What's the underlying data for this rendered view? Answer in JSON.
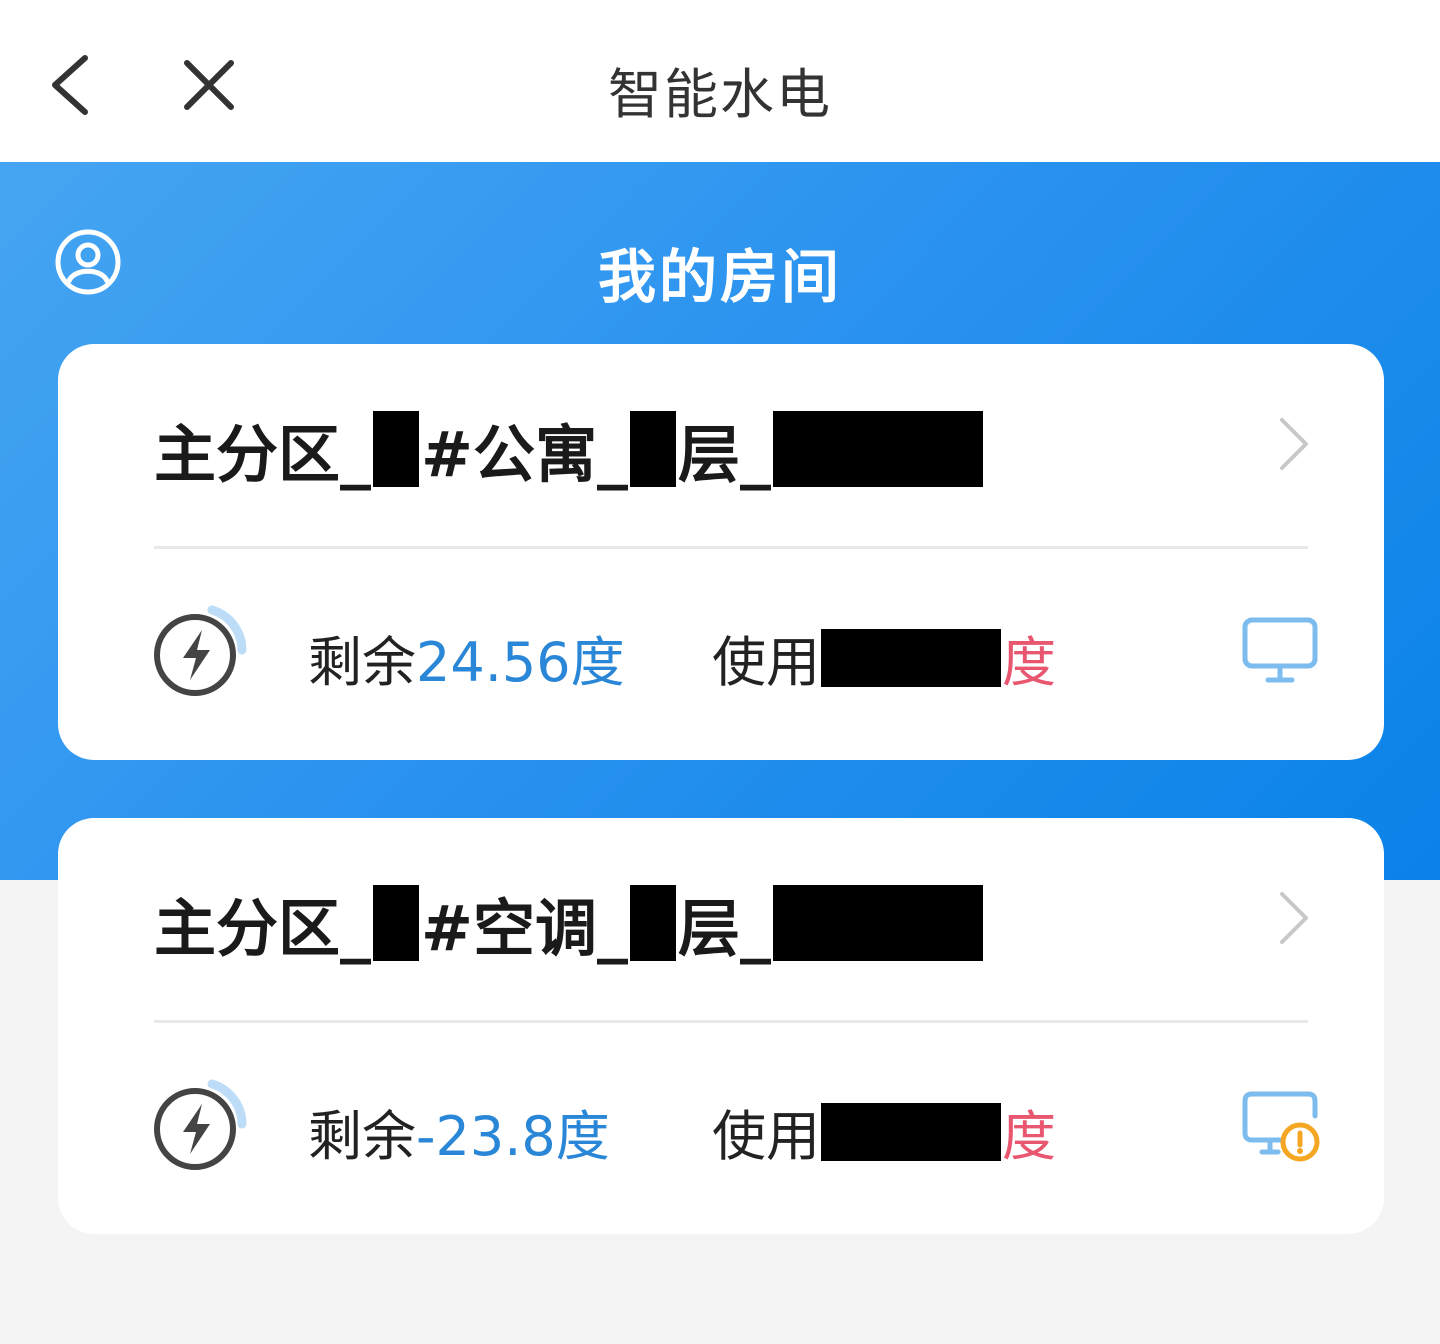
{
  "navbar": {
    "title": "智能水电"
  },
  "hero": {
    "title": "我的房间"
  },
  "cards": [
    {
      "name_parts": [
        "主分区_",
        "#公寓_",
        "层_"
      ],
      "remain_label": "剩余",
      "remain_value": "24.56度",
      "used_label": "使用",
      "used_unit": "度",
      "device_status": "normal"
    },
    {
      "name_parts": [
        "主分区_",
        "#空调_",
        "层_"
      ],
      "remain_label": "剩余",
      "remain_value": "-23.8度",
      "used_label": "使用",
      "used_unit": "度",
      "device_status": "warning"
    }
  ],
  "colors": {
    "hero_start": "#46a5f2",
    "hero_end": "#0a82e8",
    "remain_value": "#2a86d6",
    "used_unit": "#e8566f",
    "monitor": "#7cbcef",
    "warning": "#f5a623"
  },
  "icons": {
    "back": "chevron-left-icon",
    "close": "close-icon",
    "user": "user-circle-icon",
    "card_arrow": "chevron-right-icon",
    "bolt": "lightning-icon",
    "device": "monitor-icon",
    "device_warning": "monitor-warning-icon"
  }
}
